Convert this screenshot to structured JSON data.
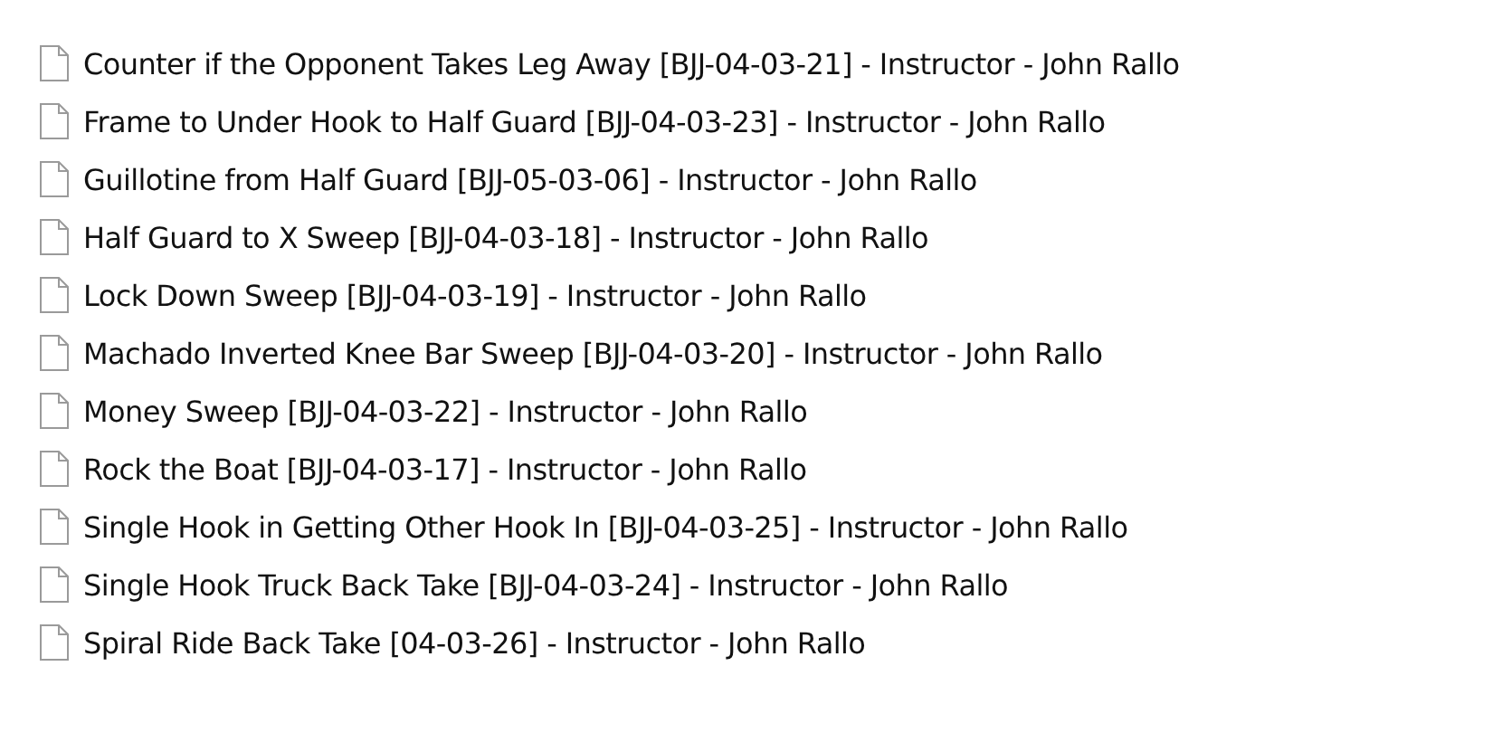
{
  "files": [
    {
      "name": "Counter if the Opponent Takes Leg Away [BJJ-04-03-21] - Instructor - John Rallo"
    },
    {
      "name": "Frame to Under Hook to Half Guard [BJJ-04-03-23] - Instructor - John Rallo"
    },
    {
      "name": "Guillotine from Half Guard [BJJ-05-03-06] - Instructor - John Rallo"
    },
    {
      "name": "Half Guard to X Sweep [BJJ-04-03-18] - Instructor - John Rallo"
    },
    {
      "name": "Lock Down Sweep [BJJ-04-03-19] - Instructor - John Rallo"
    },
    {
      "name": "Machado Inverted Knee Bar Sweep [BJJ-04-03-20] - Instructor - John Rallo"
    },
    {
      "name": "Money Sweep [BJJ-04-03-22] - Instructor - John Rallo"
    },
    {
      "name": "Rock the Boat [BJJ-04-03-17] - Instructor - John Rallo"
    },
    {
      "name": "Single Hook in Getting Other Hook In [BJJ-04-03-25] - Instructor - John Rallo"
    },
    {
      "name": "Single Hook Truck Back Take [BJJ-04-03-24] - Instructor - John Rallo"
    },
    {
      "name": "Spiral Ride Back Take [04-03-26] - Instructor - John Rallo"
    }
  ]
}
